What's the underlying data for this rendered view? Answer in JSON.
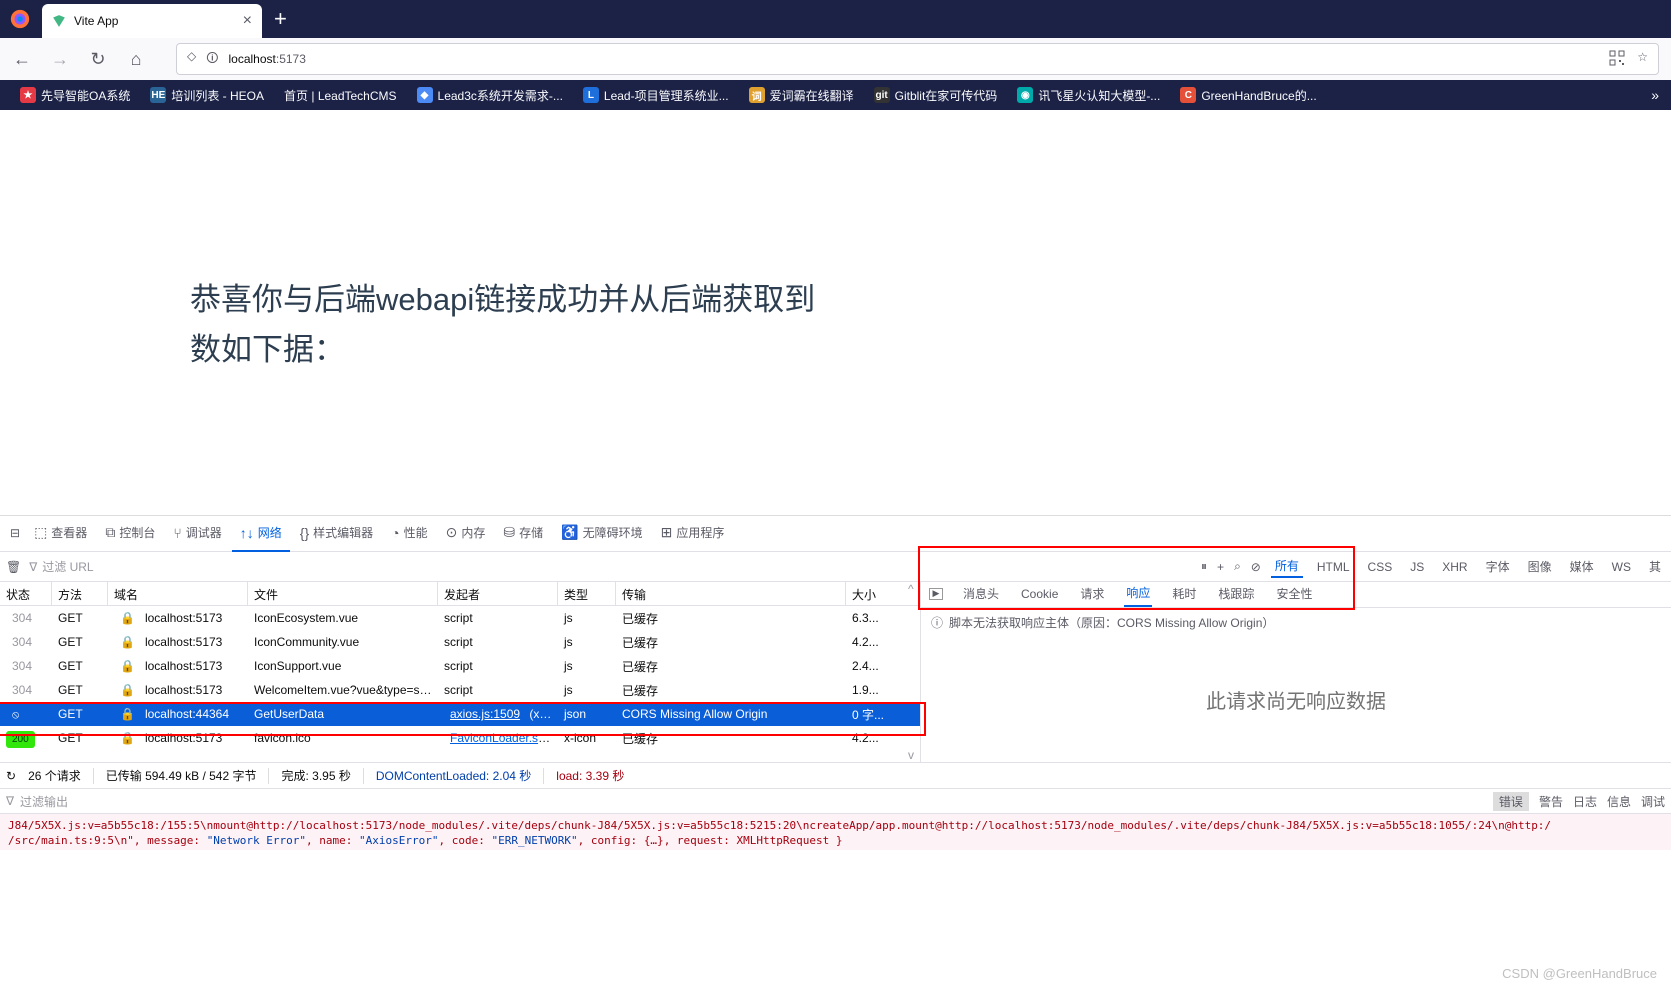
{
  "tab": {
    "title": "Vite App"
  },
  "url": {
    "host": "localhost",
    "path": ":5173"
  },
  "bookmarks": [
    {
      "label": "先导智能OA系统",
      "bg": "#e63946",
      "ch": "★"
    },
    {
      "label": "培训列表 - HEOA",
      "bg": "#2a6496",
      "ch": "HE"
    },
    {
      "label": "首页 | LeadTechCMS",
      "bg": "",
      "ch": ""
    },
    {
      "label": "Lead3c系统开发需求-...",
      "bg": "#4c8bf5",
      "ch": "◆"
    },
    {
      "label": "Lead-项目管理系统业...",
      "bg": "#1e6fdb",
      "ch": "L"
    },
    {
      "label": "爱词霸在线翻译",
      "bg": "#e0a030",
      "ch": "词"
    },
    {
      "label": "Gitblit在家可传代码",
      "bg": "#333",
      "ch": "git"
    },
    {
      "label": "讯飞星火认知大模型-...",
      "bg": "#0aa",
      "ch": "◉"
    },
    {
      "label": "GreenHandBruce的...",
      "bg": "#e55039",
      "ch": "C"
    }
  ],
  "page": {
    "line1": "恭喜你与后端webapi链接成功并从后端获取到",
    "line2": "数如下据："
  },
  "devtools": {
    "tabs": [
      "查看器",
      "控制台",
      "调试器",
      "网络",
      "样式编辑器",
      "性能",
      "内存",
      "存储",
      "无障碍环境",
      "应用程序"
    ],
    "active_tab": "网络",
    "filter_placeholder": "过滤 URL",
    "filter_types": [
      "所有",
      "HTML",
      "CSS",
      "JS",
      "XHR",
      "字体",
      "图像",
      "媒体",
      "WS",
      "其"
    ]
  },
  "net": {
    "headers": {
      "status": "状态",
      "method": "方法",
      "domain": "域名",
      "file": "文件",
      "initiator": "发起者",
      "type": "类型",
      "transfer": "传输",
      "size": "大小"
    },
    "rows": [
      {
        "status": "304",
        "method": "GET",
        "domain": "localhost:5173",
        "file": "IconEcosystem.vue",
        "initiator": "script",
        "type": "js",
        "transfer": "已缓存",
        "size": "6.3..."
      },
      {
        "status": "304",
        "method": "GET",
        "domain": "localhost:5173",
        "file": "IconCommunity.vue",
        "initiator": "script",
        "type": "js",
        "transfer": "已缓存",
        "size": "4.2..."
      },
      {
        "status": "304",
        "method": "GET",
        "domain": "localhost:5173",
        "file": "IconSupport.vue",
        "initiator": "script",
        "type": "js",
        "transfer": "已缓存",
        "size": "2.4..."
      },
      {
        "status": "304",
        "method": "GET",
        "domain": "localhost:5173",
        "file": "WelcomeItem.vue?vue&type=style",
        "initiator": "script",
        "type": "js",
        "transfer": "已缓存",
        "size": "1.9..."
      },
      {
        "status": "⦸",
        "method": "GET",
        "domain": "localhost:44364",
        "file": "GetUserData",
        "initiator": "axios.js:1509",
        "init_suffix": " (xhr)",
        "type": "json",
        "transfer": "CORS Missing Allow Origin",
        "size": "0 字...",
        "sel": true
      },
      {
        "status": "200",
        "method": "GET",
        "domain": "localhost:5173",
        "file": "favicon.ico",
        "initiator": "FaviconLoader.sys...",
        "type": "x-icon",
        "transfer": "已缓存",
        "size": "4.2..."
      }
    ],
    "footer": {
      "requests": "26 个请求",
      "transferred": "已传输 594.49 kB / 542 字节",
      "finish": "完成: 3.95 秒",
      "dcl_label": "DOMContentLoaded: ",
      "dcl_val": "2.04 秒",
      "load_label": "load: ",
      "load_val": "3.39 秒"
    }
  },
  "resp": {
    "tabs": [
      "消息头",
      "Cookie",
      "请求",
      "响应",
      "耗时",
      "栈跟踪",
      "安全性"
    ],
    "active": "响应",
    "msg": "脚本无法获取响应主体（原因：CORS Missing Allow Origin）",
    "body": "此请求尚无响应数据"
  },
  "console": {
    "filter": "过滤输出",
    "cats": [
      "错误",
      "警告",
      "日志",
      "信息",
      "调试"
    ],
    "line": "J84/5X5X.js:v=a5b55c18:/155:5\\nmount@http://localhost:5173/node_modules/.vite/deps/chunk-J84/5X5X.js:v=a5b55c18:5215:20\\ncreateApp/app.mount@http://localhost:5173/node_modules/.vite/deps/chunk-J84/5X5X.js:v=a5b55c18:1055/:24\\n@http:/",
    "line2_pre": "/src/main.ts:9:5\\n\", message: ",
    "msg": "\"Network Error\"",
    ", name: ": "",
    "name": "\"AxiosError\"",
    ", code: ": "",
    "code": "\"ERR_NETWORK\"",
    ", config: ": "",
    "cfg": "{…}",
    ", request: ": "",
    "req": "XMLHttpRequest }"
  },
  "watermark": "CSDN @GreenHandBruce"
}
